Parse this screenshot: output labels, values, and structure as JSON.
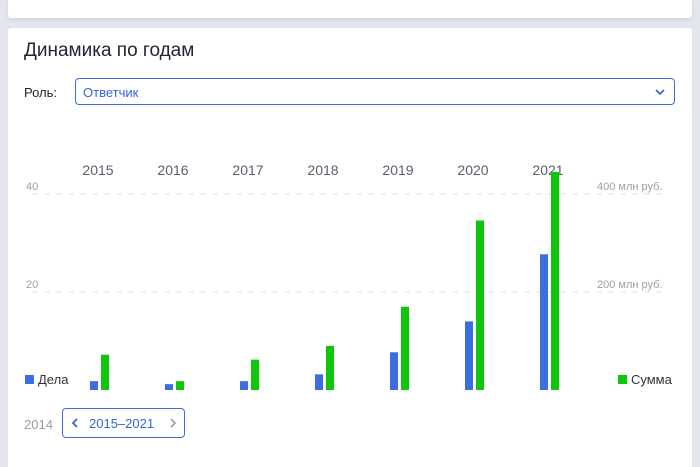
{
  "section": {
    "title": "Динамика по годам"
  },
  "filter": {
    "label": "Роль:",
    "value": "Ответчик"
  },
  "colors": {
    "cases": "#3b6fe0",
    "sum": "#10c60a",
    "accent": "#3566d4"
  },
  "chart_data": {
    "type": "bar",
    "categories": [
      "2015",
      "2016",
      "2017",
      "2018",
      "2019",
      "2020",
      "2021"
    ],
    "series": [
      {
        "name": "Дела",
        "axis": "left",
        "values": [
          1.8,
          1.2,
          1.8,
          3.2,
          7.7,
          14,
          27.7
        ]
      },
      {
        "name": "Сумма",
        "axis": "right",
        "values": [
          72,
          18,
          62,
          90,
          170,
          346,
          445
        ]
      }
    ],
    "y_left": {
      "ticks": [
        "20",
        "40"
      ],
      "tick_values": [
        20,
        40
      ],
      "range": [
        0,
        40
      ]
    },
    "y_right": {
      "ticks": [
        "200 млн руб.",
        "400 млн руб."
      ],
      "tick_values": [
        200,
        400
      ],
      "range": [
        0,
        400
      ]
    },
    "grid": true,
    "legend": {
      "left": "Дела",
      "right": "Сумма"
    }
  },
  "pager": {
    "prev_year": "2014",
    "range_label": "2015–2021"
  }
}
